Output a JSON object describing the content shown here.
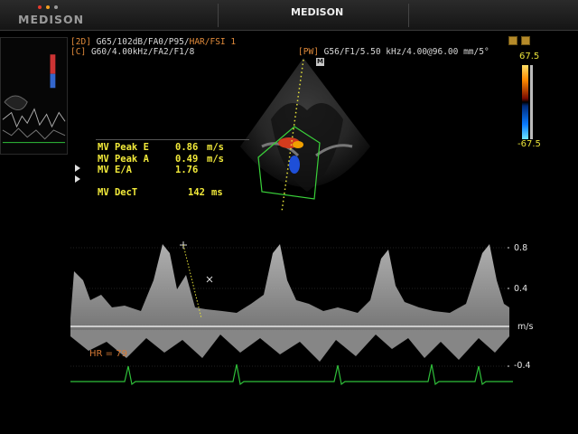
{
  "header": {
    "logo_text": "MEDISON",
    "title": "MEDISON"
  },
  "params": {
    "line_2d": {
      "mode": "2D",
      "text": "G65/102dB/FA0/P95/",
      "highlight": "HAR/FSI 1"
    },
    "line_c": {
      "mode": "C",
      "text": "G60/4.00kHz/FA2/F1/8"
    },
    "line_pw": {
      "mode": "PW",
      "text": "G56/F1/5.50 kHz/4.00@96.00 mm/5°"
    }
  },
  "measurements": [
    {
      "label": "MV Peak E",
      "value": "0.86",
      "unit": "m/s"
    },
    {
      "label": "MV Peak A",
      "value": "0.49",
      "unit": "m/s"
    },
    {
      "label": "MV E/A",
      "value": "1.76",
      "unit": ""
    },
    {
      "label": "MV DecT",
      "value": "142",
      "unit": "ms"
    }
  ],
  "colorbar": {
    "max": "67.5",
    "min": "-67.5"
  },
  "spectral_scale": {
    "labels": [
      "0.8",
      "0.4",
      "m/s",
      "-0.4"
    ]
  },
  "ecg": {
    "hr_text": "HR = 79"
  },
  "colors": {
    "measurement_text": "#f2ea3a",
    "param_highlight": "#e08a3a",
    "ecg_trace": "#2fbf3a",
    "logo_dot_1": "#e53b2e",
    "logo_dot_2": "#f2a022",
    "logo_dot_3": "#9a9a9a"
  }
}
